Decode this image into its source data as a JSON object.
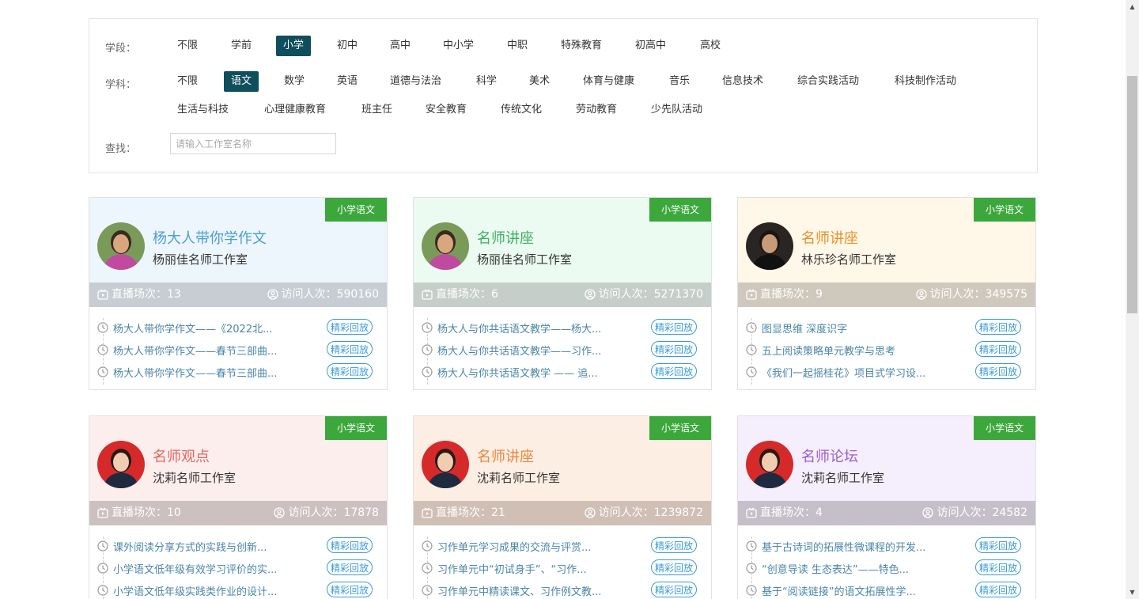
{
  "filters": {
    "stage_label": "学段：",
    "stage_options": [
      "不限",
      "学前",
      "小学",
      "初中",
      "高中",
      "中小学",
      "中职",
      "特殊教育",
      "初高中",
      "高校"
    ],
    "subject_label": "学科：",
    "subject_options": [
      "不限",
      "语文",
      "数学",
      "英语",
      "道德与法治",
      "科学",
      "美术",
      "体育与健康",
      "音乐",
      "信息技术",
      "综合实践活动",
      "科技制作活动",
      "生活与科技",
      "心理健康教育",
      "班主任",
      "安全教育",
      "传统文化",
      "劳动教育",
      "少先队活动"
    ],
    "search_label": "查找：",
    "search_placeholder": "请输入工作室名称",
    "search_value": ""
  },
  "cards": [
    {
      "badge": "小学语文",
      "title": "杨大人带你学作文",
      "subtitle": "杨丽佳名师工作室",
      "live_count": "直播场次：13",
      "visit_count": "访问人次：590160",
      "colors": {
        "bg": "#eef6fd",
        "title": "#4a9ed0",
        "stats": "#c7cdd2"
      },
      "items": [
        {
          "text": "杨大人带你学作文——《2022北...",
          "button": "精彩回放"
        },
        {
          "text": "杨大人带你学作文——春节三部曲...",
          "button": "精彩回放"
        },
        {
          "text": "杨大人带你学作文——春节三部曲...",
          "button": "精彩回放"
        }
      ]
    },
    {
      "badge": "小学语文",
      "title": "名师讲座",
      "subtitle": "杨丽佳名师工作室",
      "live_count": "直播场次：6",
      "visit_count": "访问人次：5271370",
      "colors": {
        "bg": "#ebfbf1",
        "title": "#3fae66",
        "stats": "#c6cec9"
      },
      "items": [
        {
          "text": "杨大人与你共话语文教学——杨大...",
          "button": "精彩回放"
        },
        {
          "text": "杨大人与你共话语文教学——习作...",
          "button": "精彩回放"
        },
        {
          "text": "杨大人与你共话语文教学 —— 追...",
          "button": "精彩回放"
        }
      ]
    },
    {
      "badge": "小学语文",
      "title": "名师讲座",
      "subtitle": "林乐珍名师工作室",
      "live_count": "直播场次：9",
      "visit_count": "访问人次：349575",
      "colors": {
        "bg": "#fff7e8",
        "title": "#e8932a",
        "stats": "#cfc9bd"
      },
      "items": [
        {
          "text": "图显思维 深度识字",
          "button": "精彩回放"
        },
        {
          "text": "五上阅读策略单元教学与思考",
          "button": "精彩回放"
        },
        {
          "text": "《我们一起摇桂花》项目式学习设...",
          "button": "精彩回放"
        }
      ]
    },
    {
      "badge": "小学语文",
      "title": "名师观点",
      "subtitle": "沈莉名师工作室",
      "live_count": "直播场次：10",
      "visit_count": "访问人次：17878",
      "colors": {
        "bg": "#fdeeee",
        "title": "#e5655e",
        "stats": "#cdc0c0"
      },
      "items": [
        {
          "text": "课外阅读分享方式的实践与创新...",
          "button": "精彩回放"
        },
        {
          "text": "小学语文低年级有效学习评价的实...",
          "button": "精彩回放"
        },
        {
          "text": "小学语文低年级实践类作业的设计...",
          "button": "精彩回放"
        }
      ]
    },
    {
      "badge": "小学语文",
      "title": "名师讲座",
      "subtitle": "沈莉名师工作室",
      "live_count": "直播场次：21",
      "visit_count": "访问人次：1239872",
      "colors": {
        "bg": "#fdeee4",
        "title": "#e8893e",
        "stats": "#cfbfb5"
      },
      "items": [
        {
          "text": "习作单元学习成果的交流与评赏...",
          "button": "精彩回放"
        },
        {
          "text": "习作单元中“初试身手”、“习作...",
          "button": "精彩回放"
        },
        {
          "text": "习作单元中精读课文、习作例文教...",
          "button": "精彩回放"
        }
      ]
    },
    {
      "badge": "小学语文",
      "title": "名师论坛",
      "subtitle": "沈莉名师工作室",
      "live_count": "直播场次：4",
      "visit_count": "访问人次：24582",
      "colors": {
        "bg": "#f5eefc",
        "title": "#9b5fcc",
        "stats": "#c5bfca"
      },
      "items": [
        {
          "text": "基于古诗词的拓展性微课程的开发...",
          "button": "精彩回放"
        },
        {
          "text": "“创意导读 生态表达”——特色...",
          "button": "精彩回放"
        },
        {
          "text": "基于“阅读链接”的语文拓展性学...",
          "button": "精彩回放"
        }
      ]
    }
  ]
}
